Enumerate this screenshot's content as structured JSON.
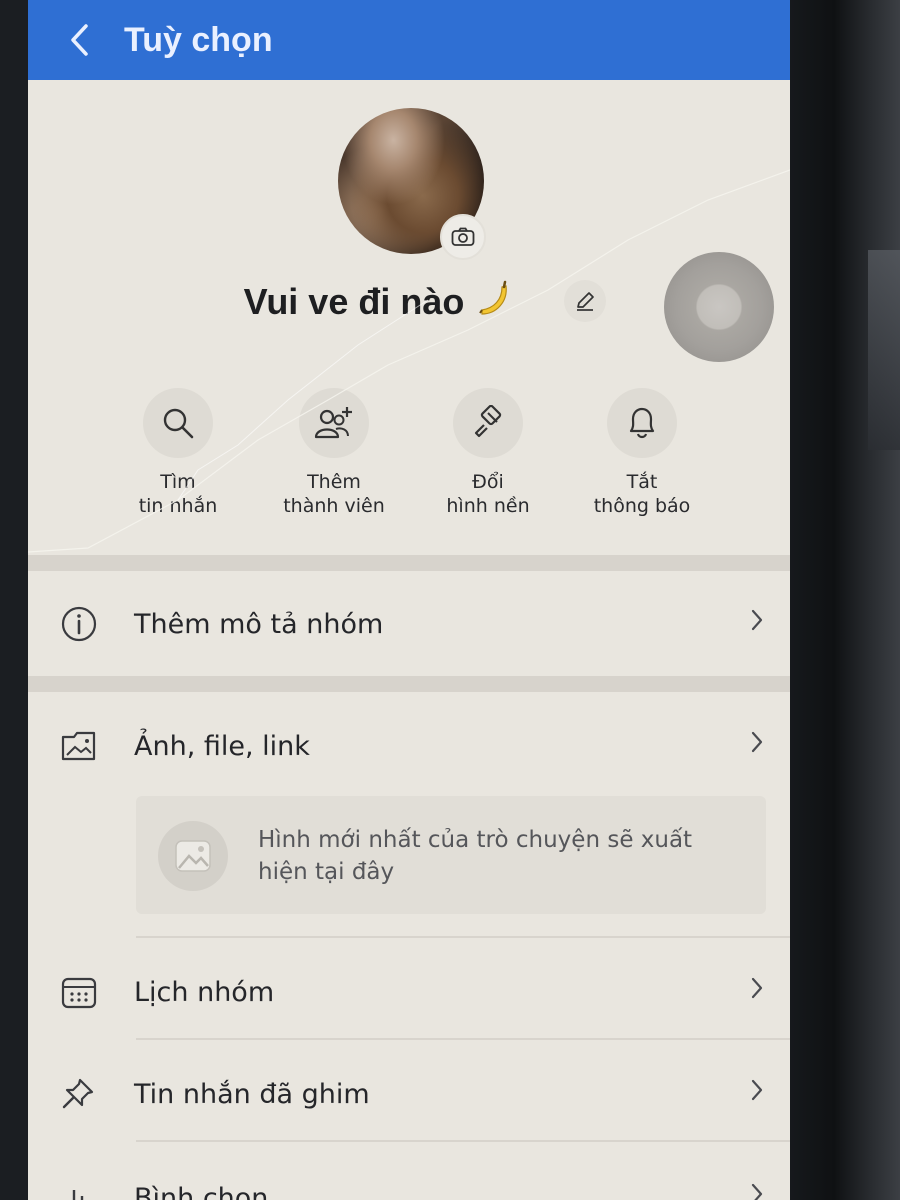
{
  "header": {
    "title": "Tuỳ chọn"
  },
  "profile": {
    "group_name": "Vui ve đi nào"
  },
  "quick_actions": [
    {
      "label": "Tìm\ntin nhắn",
      "icon": "search-icon"
    },
    {
      "label": "Thêm\nthành viên",
      "icon": "add-member-icon"
    },
    {
      "label": "Đổi\nhình nền",
      "icon": "paint-brush-icon"
    },
    {
      "label": "Tắt\nthông báo",
      "icon": "bell-icon"
    }
  ],
  "menu": {
    "description": {
      "label": "Thêm mô tả nhóm",
      "icon": "info-icon"
    },
    "media": {
      "label": "Ảnh, file, link",
      "icon": "photo-folder-icon",
      "empty_hint": "Hình mới nhất của trò chuyện sẽ xuất hiện tại đây"
    },
    "calendar": {
      "label": "Lịch nhóm",
      "icon": "calendar-icon"
    },
    "pinned": {
      "label": "Tin nhắn đã ghim",
      "icon": "pin-icon"
    },
    "poll": {
      "label": "Bình chọn",
      "icon": "poll-icon"
    }
  },
  "colors": {
    "header": "#2f6fd3",
    "background": "#e9e6df",
    "text": "#25262a"
  }
}
